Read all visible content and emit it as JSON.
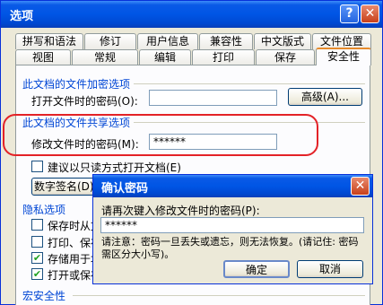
{
  "window": {
    "title": "选项",
    "help_icon": "?",
    "close_icon": "✕"
  },
  "tabs_row1": [
    "拼写和语法",
    "修订",
    "用户信息",
    "兼容性",
    "中文版式",
    "文件位置"
  ],
  "tabs_row2": [
    "视图",
    "常规",
    "编辑",
    "打印",
    "保存",
    "安全性"
  ],
  "active_tab": "安全性",
  "encrypt": {
    "section": "此文档的文件加密选项",
    "open_password_label": "打开文件时的密码(O):",
    "open_password_value": "",
    "advanced_button": "高级(A)..."
  },
  "share": {
    "section": "此文档的文件共享选项",
    "modify_password_label": "修改文件时的密码(M):",
    "modify_password_value": "******",
    "readonly_label": "建议以只读方式打开文档(E)",
    "digital_signature_button": "数字签名(D)..."
  },
  "privacy": {
    "section": "隐私选项",
    "items": [
      {
        "label": "保存时从文",
        "checked": false
      },
      {
        "label": "打印、保存",
        "checked": false
      },
      {
        "label": "存储用于坦",
        "checked": true
      },
      {
        "label": "打开或保存",
        "checked": true
      }
    ]
  },
  "macro": {
    "section": "宏安全性"
  },
  "confirm": {
    "title": "确认密码",
    "prompt": "请再次键入修改文件时的密码(P):",
    "value": "******",
    "note": "请注意：密码一旦丢失或遗忘，则无法恢复。(请记住: 密码需区分大小写)。",
    "ok": "确定",
    "cancel": "取消"
  },
  "colors": {
    "titlebar": "#0055e5",
    "highlight_ring": "#e32227",
    "section_text": "#0046d5"
  }
}
